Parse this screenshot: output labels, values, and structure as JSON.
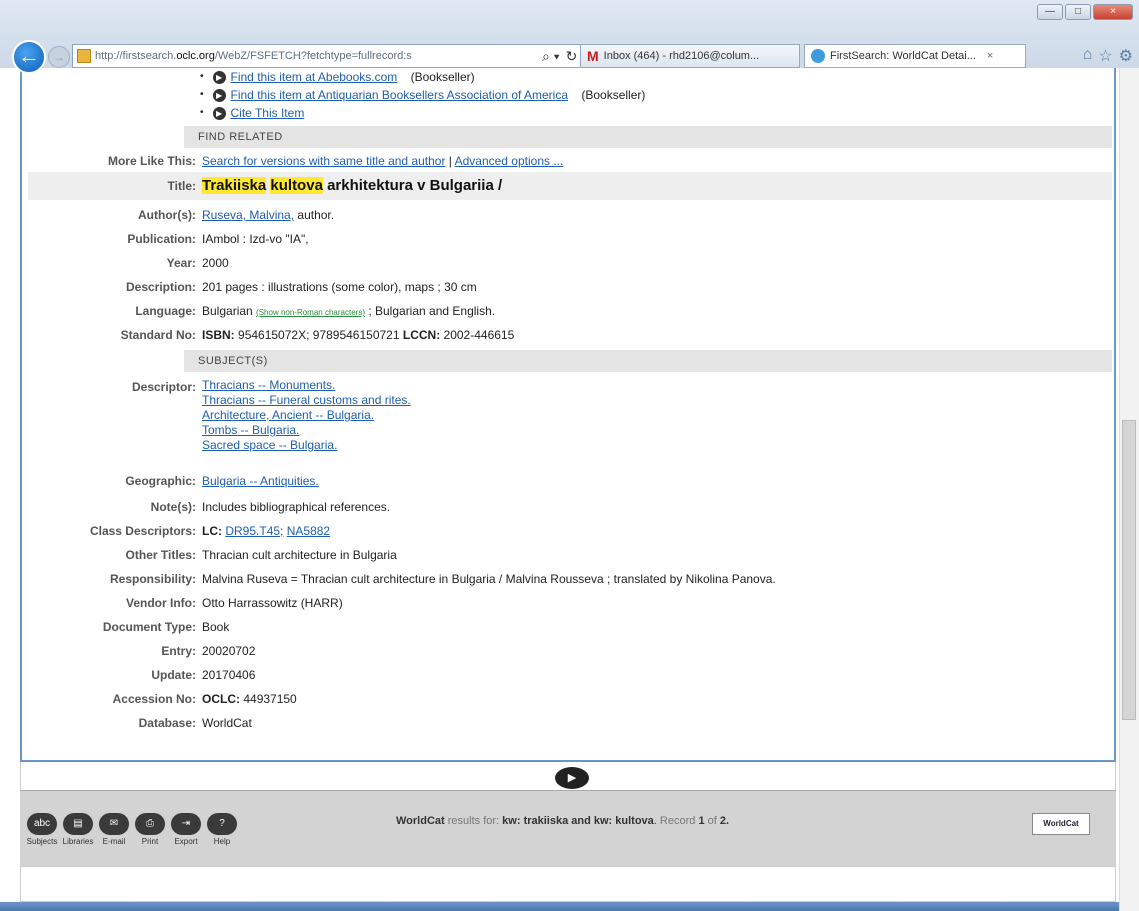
{
  "browser": {
    "url_prefix": "http://firstsearch.",
    "url_domain": "oclc.org",
    "url_suffix": "/WebZ/FSFETCH?fetchtype=fullrecord:s",
    "search_glyph": "⌕ ▾",
    "refresh_glyph": "↻",
    "tabs": [
      {
        "icon": "gmail-icon",
        "title": "Inbox (464) - rhd2106@colum...",
        "close": ""
      },
      {
        "icon": "ie-icon",
        "title": "FirstSearch: WorldCat Detai...",
        "close": "×"
      }
    ],
    "window_controls": {
      "minimize": "—",
      "maximize": "□",
      "close": "×"
    }
  },
  "links": [
    {
      "text": "Find this item at Abebooks.com",
      "suffix": "(Bookseller)"
    },
    {
      "text": "Find this item at Antiquarian Booksellers Association of America",
      "suffix": "(Bookseller)"
    },
    {
      "text": "Cite This Item",
      "suffix": ""
    }
  ],
  "sections": {
    "find_related": "FIND RELATED",
    "subjects": "SUBJECT(S)"
  },
  "record": {
    "more_like_this": {
      "label": "More Like This:",
      "link1": "Search for versions with same title and author",
      "sep": "|",
      "link2": "Advanced options ..."
    },
    "title": {
      "label": "Title:",
      "hl1": "Trakiiska",
      "hl2": "kultova",
      "rest": "arkhitektura v Bulgariia /"
    },
    "authors": {
      "label": "Author(s):",
      "link": "Ruseva, Malvina,",
      "suffix": "author."
    },
    "publication": {
      "label": "Publication:",
      "value": "IAmbol : Izd-vo \"IA\","
    },
    "year": {
      "label": "Year:",
      "value": "2000"
    },
    "description": {
      "label": "Description:",
      "value": "201 pages : illustrations (some color), maps ; 30 cm"
    },
    "language": {
      "label": "Language:",
      "value": "Bulgarian",
      "small_link": "(Show non-Roman characters)",
      "suffix": "; Bulgarian and English."
    },
    "standard_no": {
      "label": "Standard No:",
      "isbn_label": "ISBN:",
      "isbn": "954615072X; 9789546150721",
      "lccn_label": "LCCN:",
      "lccn": "2002-446615"
    },
    "descriptor": {
      "label": "Descriptor:",
      "items": [
        "Thracians -- Monuments.",
        "Thracians -- Funeral customs and rites.",
        "Architecture, Ancient -- Bulgaria.",
        "Tombs -- Bulgaria.",
        "Sacred space -- Bulgaria."
      ]
    },
    "geographic": {
      "label": "Geographic:",
      "link": "Bulgaria -- Antiquities."
    },
    "notes": {
      "label": "Note(s):",
      "value": "Includes bibliographical references."
    },
    "class_descriptors": {
      "label": "Class Descriptors:",
      "lc_label": "LC:",
      "lc1": "DR95.T45;",
      "lc2": "NA5882"
    },
    "other_titles": {
      "label": "Other Titles:",
      "value": "Thracian cult architecture in Bulgaria"
    },
    "responsibility": {
      "label": "Responsibility:",
      "value": "Malvina Ruseva = Thracian cult architecture in Bulgaria / Malvina Rousseva ; translated by Nikolina Panova."
    },
    "vendor_info": {
      "label": "Vendor Info:",
      "value": "Otto Harrassowitz (HARR)"
    },
    "document_type": {
      "label": "Document Type:",
      "value": "Book"
    },
    "entry": {
      "label": "Entry:",
      "value": "20020702"
    },
    "update": {
      "label": "Update:",
      "value": "20170406"
    },
    "accession": {
      "label": "Accession No:",
      "oclc_label": "OCLC:",
      "value": "44937150"
    },
    "database": {
      "label": "Database:",
      "value": "WorldCat"
    }
  },
  "toolbar": {
    "tools": [
      {
        "name": "subjects",
        "label": "Subjects",
        "icon": "abc"
      },
      {
        "name": "libraries",
        "label": "Libraries",
        "icon": "▤"
      },
      {
        "name": "email",
        "label": "E-mail",
        "icon": "✉"
      },
      {
        "name": "print",
        "label": "Print",
        "icon": "⎙"
      },
      {
        "name": "export",
        "label": "Export",
        "icon": "⇥"
      },
      {
        "name": "help",
        "label": "Help",
        "icon": "?"
      }
    ],
    "results_prefix": "WorldCat",
    "results_mid": "results for:",
    "query": "kw: trakiiska and kw: kultova",
    "record_text": "Record",
    "record_num": "1",
    "of_text": "of",
    "total": "2.",
    "logo": "WorldCat",
    "next_glyph": "▶"
  }
}
